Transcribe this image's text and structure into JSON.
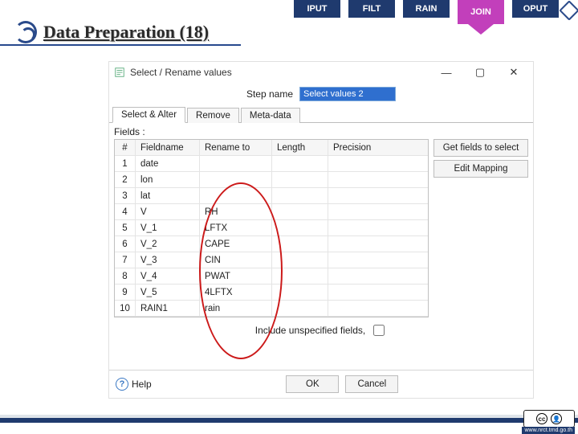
{
  "tabs": {
    "items": [
      "IPUT",
      "FILT",
      "RAIN",
      "JOIN",
      "OPUT"
    ],
    "active_index": 3
  },
  "slide_title": "Data Preparation (18)",
  "dialog": {
    "title": "Select / Rename values",
    "window_controls": {
      "min": "—",
      "max": "▢",
      "close": "✕"
    },
    "step_name_label": "Step name",
    "step_name_value": "Select values 2",
    "inner_tabs": [
      "Select & Alter",
      "Remove",
      "Meta-data"
    ],
    "inner_tab_selected": 0,
    "fields_label": "Fields :",
    "grid": {
      "headers": {
        "idx": "#",
        "fieldname": "Fieldname",
        "rename": "Rename to",
        "length": "Length",
        "precision": "Precision"
      },
      "rows": [
        {
          "idx": "1",
          "field": "date",
          "rename": ""
        },
        {
          "idx": "2",
          "field": "lon",
          "rename": ""
        },
        {
          "idx": "3",
          "field": "lat",
          "rename": ""
        },
        {
          "idx": "4",
          "field": "V",
          "rename": "RH"
        },
        {
          "idx": "5",
          "field": "V_1",
          "rename": "LFTX"
        },
        {
          "idx": "6",
          "field": "V_2",
          "rename": "CAPE"
        },
        {
          "idx": "7",
          "field": "V_3",
          "rename": "CIN"
        },
        {
          "idx": "8",
          "field": "V_4",
          "rename": "PWAT"
        },
        {
          "idx": "9",
          "field": "V_5",
          "rename": "4LFTX"
        },
        {
          "idx": "10",
          "field": "RAIN1",
          "rename": "rain"
        }
      ]
    },
    "buttons": {
      "get_fields": "Get fields to select",
      "edit_mapping": "Edit Mapping",
      "ok": "OK",
      "cancel": "Cancel",
      "help": "Help"
    },
    "include_label": "Include unspecified fields,"
  },
  "footer": {
    "cc": "cc",
    "url": "www.nrct.tmd.go.th"
  }
}
